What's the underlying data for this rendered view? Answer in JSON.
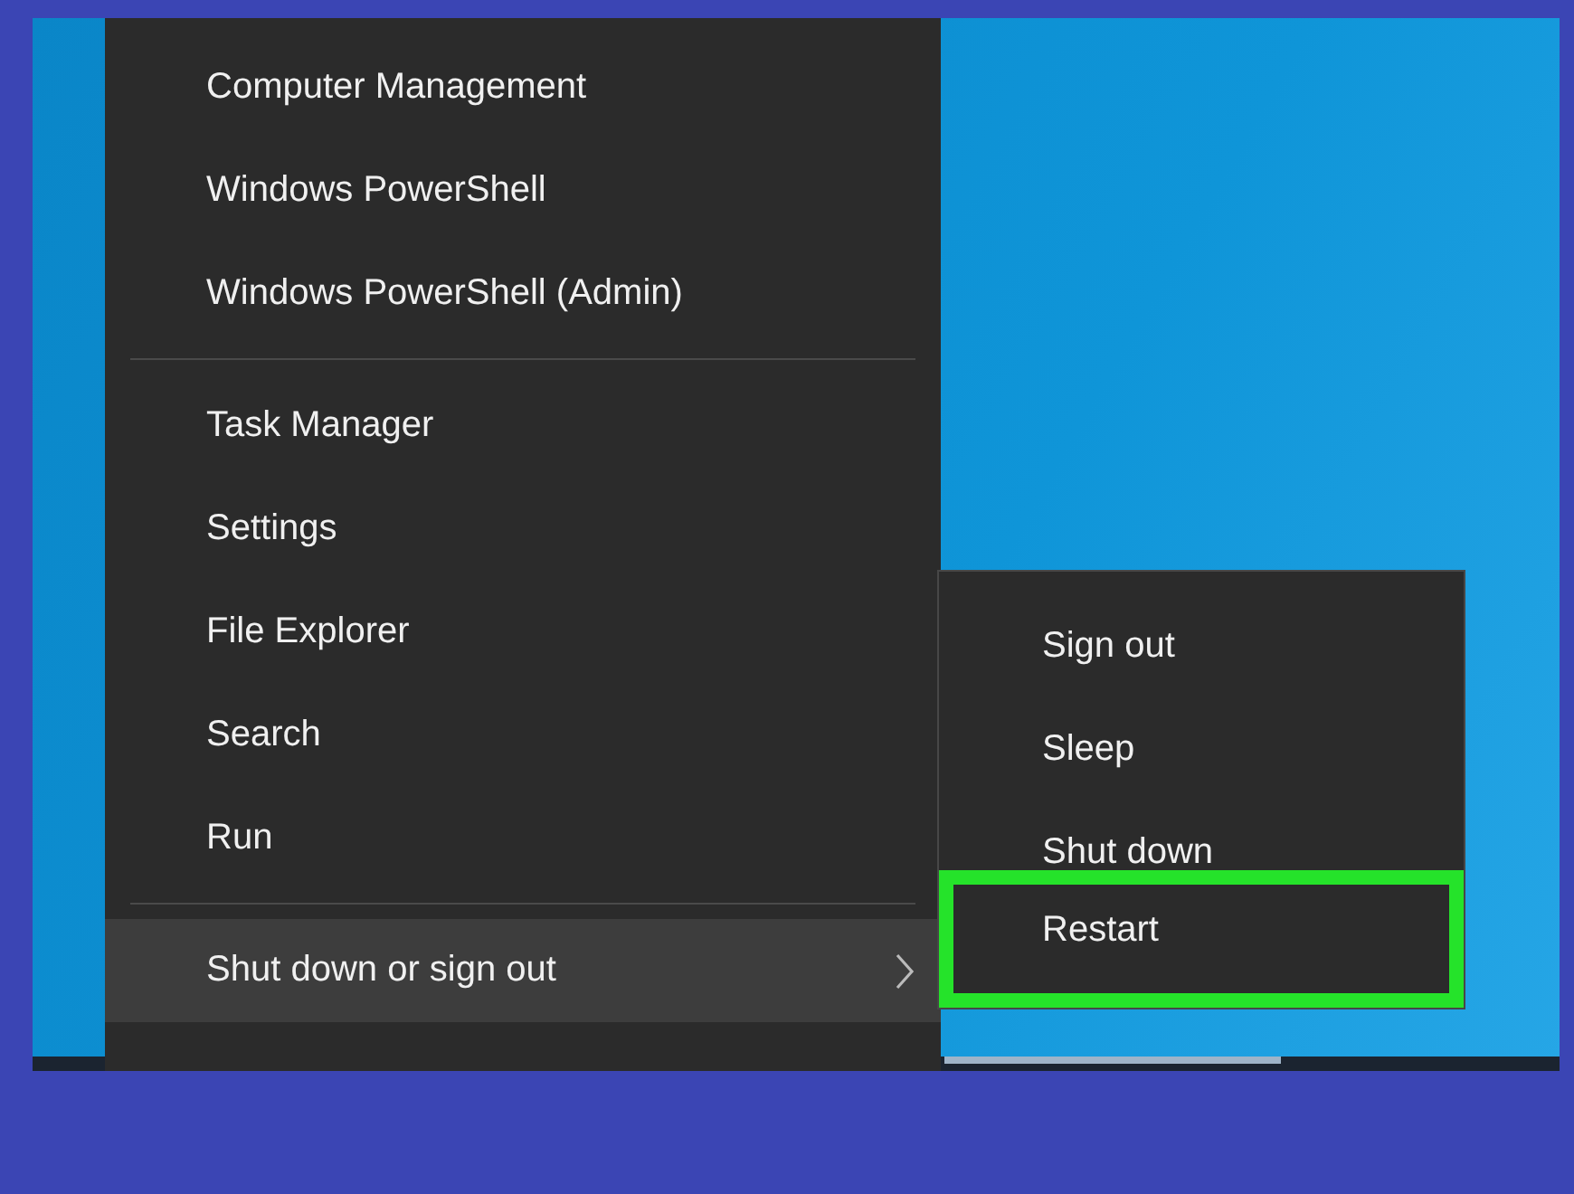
{
  "menu": {
    "sections": [
      {
        "items": [
          {
            "label": "Computer Management",
            "selected": false,
            "kind": "plain"
          },
          {
            "label": "Windows PowerShell",
            "selected": false,
            "kind": "plain"
          },
          {
            "label": "Windows PowerShell (Admin)",
            "selected": false,
            "kind": "plain"
          }
        ]
      },
      {
        "items": [
          {
            "label": "Task Manager",
            "selected": false,
            "kind": "plain"
          },
          {
            "label": "Settings",
            "selected": false,
            "kind": "plain"
          },
          {
            "label": "File Explorer",
            "selected": false,
            "kind": "plain"
          },
          {
            "label": "Search",
            "selected": false,
            "kind": "plain"
          },
          {
            "label": "Run",
            "selected": false,
            "kind": "plain"
          }
        ]
      },
      {
        "items": [
          {
            "label": "Shut down or sign out",
            "selected": true,
            "kind": "submenu"
          }
        ]
      }
    ]
  },
  "submenu": {
    "items": [
      {
        "label": "Sign out",
        "highlighted": false
      },
      {
        "label": "Sleep",
        "highlighted": false
      },
      {
        "label": "Shut down",
        "highlighted": false
      },
      {
        "label": "Restart",
        "highlighted": true
      }
    ]
  }
}
